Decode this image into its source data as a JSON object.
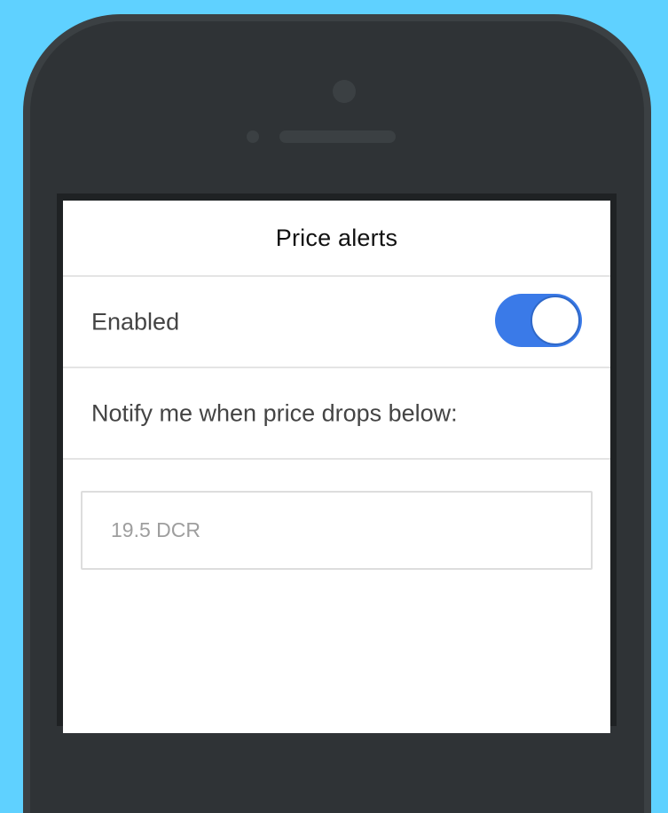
{
  "header": {
    "title": "Price alerts"
  },
  "alerts": {
    "enabled_label": "Enabled",
    "enabled_state": true,
    "notify_label": "Notify me when price drops below:",
    "price_input": {
      "value": "",
      "placeholder": "19.5 DCR"
    }
  },
  "colors": {
    "background": "#5fd1ff",
    "phone_body": "#3b4043",
    "toggle_on": "#3a7ae8",
    "screen": "#ffffff"
  }
}
